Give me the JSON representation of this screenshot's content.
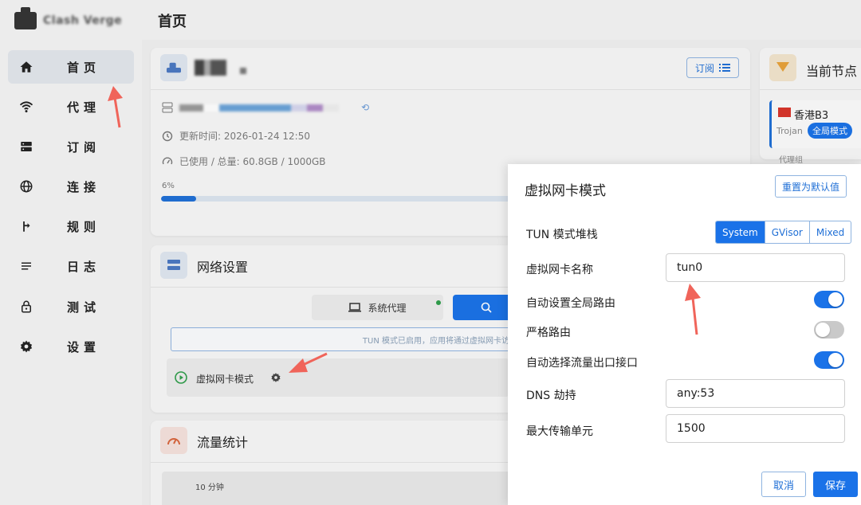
{
  "app": {
    "name": "Clash Verge"
  },
  "sidebar": {
    "items": [
      {
        "label": "首页",
        "icon": "home-icon",
        "active": true
      },
      {
        "label": "代理",
        "icon": "wifi-icon"
      },
      {
        "label": "订阅",
        "icon": "server-icon"
      },
      {
        "label": "连接",
        "icon": "globe-icon"
      },
      {
        "label": "规则",
        "icon": "route-icon"
      },
      {
        "label": "日志",
        "icon": "list-icon"
      },
      {
        "label": "测试",
        "icon": "lock-icon"
      },
      {
        "label": "设置",
        "icon": "gear-icon"
      }
    ]
  },
  "header": {
    "title": "首页"
  },
  "profile_card": {
    "subscribe_label": "订阅",
    "updated_text": "更新时间: 2026-01-24 12:50",
    "usage_text": "已使用 / 总量: 60.8GB / 1000GB",
    "progress_label": "6%",
    "progress_value": 0.06
  },
  "current_node_card": {
    "title": "当前节点",
    "node_name": "香港B3",
    "protocol": "Trojan",
    "mode_badge": "全局模式",
    "group_label": "代理组"
  },
  "network_card": {
    "title": "网络设置",
    "system_proxy_label": "系统代理",
    "tun_notice": "TUN 模式已启用，应用将通过虚拟网卡访",
    "tun_mode_label": "虚拟网卡模式"
  },
  "traffic_card": {
    "title": "流量统计",
    "range_label": "10 分钟"
  },
  "modal": {
    "title": "虚拟网卡模式",
    "reset_label": "重置为默认值",
    "stack_label": "TUN 模式堆栈",
    "stack_options": [
      "System",
      "GVisor",
      "Mixed"
    ],
    "stack_selected": "System",
    "nic_name_label": "虚拟网卡名称",
    "nic_name_value": "tun0",
    "auto_route_label": "自动设置全局路由",
    "auto_route_on": true,
    "strict_route_label": "严格路由",
    "strict_route_on": false,
    "auto_detect_label": "自动选择流量出口接口",
    "auto_detect_on": true,
    "dns_hijack_label": "DNS 劫持",
    "dns_hijack_value": "any:53",
    "mtu_label": "最大传输单元",
    "mtu_value": "1500",
    "cancel_label": "取消",
    "save_label": "保存"
  },
  "colors": {
    "accent": "#1a72e8",
    "arrow": "#f0645a"
  }
}
